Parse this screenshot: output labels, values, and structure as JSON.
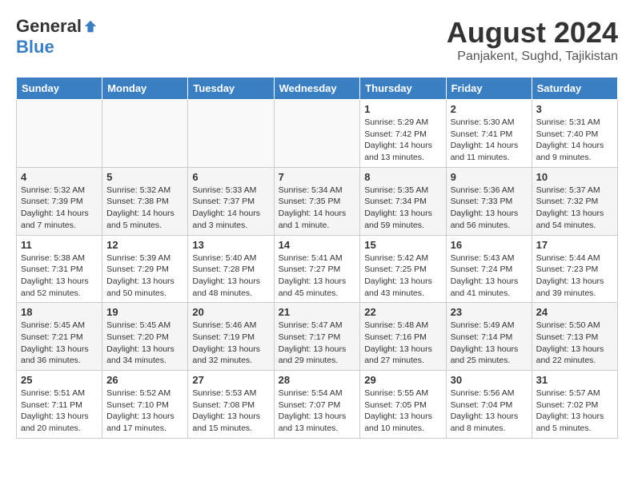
{
  "header": {
    "logo_general": "General",
    "logo_blue": "Blue",
    "month_year": "August 2024",
    "location": "Panjakent, Sughd, Tajikistan"
  },
  "days_of_week": [
    "Sunday",
    "Monday",
    "Tuesday",
    "Wednesday",
    "Thursday",
    "Friday",
    "Saturday"
  ],
  "weeks": [
    [
      {
        "day": "",
        "detail": ""
      },
      {
        "day": "",
        "detail": ""
      },
      {
        "day": "",
        "detail": ""
      },
      {
        "day": "",
        "detail": ""
      },
      {
        "day": "1",
        "detail": "Sunrise: 5:29 AM\nSunset: 7:42 PM\nDaylight: 14 hours\nand 13 minutes."
      },
      {
        "day": "2",
        "detail": "Sunrise: 5:30 AM\nSunset: 7:41 PM\nDaylight: 14 hours\nand 11 minutes."
      },
      {
        "day": "3",
        "detail": "Sunrise: 5:31 AM\nSunset: 7:40 PM\nDaylight: 14 hours\nand 9 minutes."
      }
    ],
    [
      {
        "day": "4",
        "detail": "Sunrise: 5:32 AM\nSunset: 7:39 PM\nDaylight: 14 hours\nand 7 minutes."
      },
      {
        "day": "5",
        "detail": "Sunrise: 5:32 AM\nSunset: 7:38 PM\nDaylight: 14 hours\nand 5 minutes."
      },
      {
        "day": "6",
        "detail": "Sunrise: 5:33 AM\nSunset: 7:37 PM\nDaylight: 14 hours\nand 3 minutes."
      },
      {
        "day": "7",
        "detail": "Sunrise: 5:34 AM\nSunset: 7:35 PM\nDaylight: 14 hours\nand 1 minute."
      },
      {
        "day": "8",
        "detail": "Sunrise: 5:35 AM\nSunset: 7:34 PM\nDaylight: 13 hours\nand 59 minutes."
      },
      {
        "day": "9",
        "detail": "Sunrise: 5:36 AM\nSunset: 7:33 PM\nDaylight: 13 hours\nand 56 minutes."
      },
      {
        "day": "10",
        "detail": "Sunrise: 5:37 AM\nSunset: 7:32 PM\nDaylight: 13 hours\nand 54 minutes."
      }
    ],
    [
      {
        "day": "11",
        "detail": "Sunrise: 5:38 AM\nSunset: 7:31 PM\nDaylight: 13 hours\nand 52 minutes."
      },
      {
        "day": "12",
        "detail": "Sunrise: 5:39 AM\nSunset: 7:29 PM\nDaylight: 13 hours\nand 50 minutes."
      },
      {
        "day": "13",
        "detail": "Sunrise: 5:40 AM\nSunset: 7:28 PM\nDaylight: 13 hours\nand 48 minutes."
      },
      {
        "day": "14",
        "detail": "Sunrise: 5:41 AM\nSunset: 7:27 PM\nDaylight: 13 hours\nand 45 minutes."
      },
      {
        "day": "15",
        "detail": "Sunrise: 5:42 AM\nSunset: 7:25 PM\nDaylight: 13 hours\nand 43 minutes."
      },
      {
        "day": "16",
        "detail": "Sunrise: 5:43 AM\nSunset: 7:24 PM\nDaylight: 13 hours\nand 41 minutes."
      },
      {
        "day": "17",
        "detail": "Sunrise: 5:44 AM\nSunset: 7:23 PM\nDaylight: 13 hours\nand 39 minutes."
      }
    ],
    [
      {
        "day": "18",
        "detail": "Sunrise: 5:45 AM\nSunset: 7:21 PM\nDaylight: 13 hours\nand 36 minutes."
      },
      {
        "day": "19",
        "detail": "Sunrise: 5:45 AM\nSunset: 7:20 PM\nDaylight: 13 hours\nand 34 minutes."
      },
      {
        "day": "20",
        "detail": "Sunrise: 5:46 AM\nSunset: 7:19 PM\nDaylight: 13 hours\nand 32 minutes."
      },
      {
        "day": "21",
        "detail": "Sunrise: 5:47 AM\nSunset: 7:17 PM\nDaylight: 13 hours\nand 29 minutes."
      },
      {
        "day": "22",
        "detail": "Sunrise: 5:48 AM\nSunset: 7:16 PM\nDaylight: 13 hours\nand 27 minutes."
      },
      {
        "day": "23",
        "detail": "Sunrise: 5:49 AM\nSunset: 7:14 PM\nDaylight: 13 hours\nand 25 minutes."
      },
      {
        "day": "24",
        "detail": "Sunrise: 5:50 AM\nSunset: 7:13 PM\nDaylight: 13 hours\nand 22 minutes."
      }
    ],
    [
      {
        "day": "25",
        "detail": "Sunrise: 5:51 AM\nSunset: 7:11 PM\nDaylight: 13 hours\nand 20 minutes."
      },
      {
        "day": "26",
        "detail": "Sunrise: 5:52 AM\nSunset: 7:10 PM\nDaylight: 13 hours\nand 17 minutes."
      },
      {
        "day": "27",
        "detail": "Sunrise: 5:53 AM\nSunset: 7:08 PM\nDaylight: 13 hours\nand 15 minutes."
      },
      {
        "day": "28",
        "detail": "Sunrise: 5:54 AM\nSunset: 7:07 PM\nDaylight: 13 hours\nand 13 minutes."
      },
      {
        "day": "29",
        "detail": "Sunrise: 5:55 AM\nSunset: 7:05 PM\nDaylight: 13 hours\nand 10 minutes."
      },
      {
        "day": "30",
        "detail": "Sunrise: 5:56 AM\nSunset: 7:04 PM\nDaylight: 13 hours\nand 8 minutes."
      },
      {
        "day": "31",
        "detail": "Sunrise: 5:57 AM\nSunset: 7:02 PM\nDaylight: 13 hours\nand 5 minutes."
      }
    ]
  ]
}
